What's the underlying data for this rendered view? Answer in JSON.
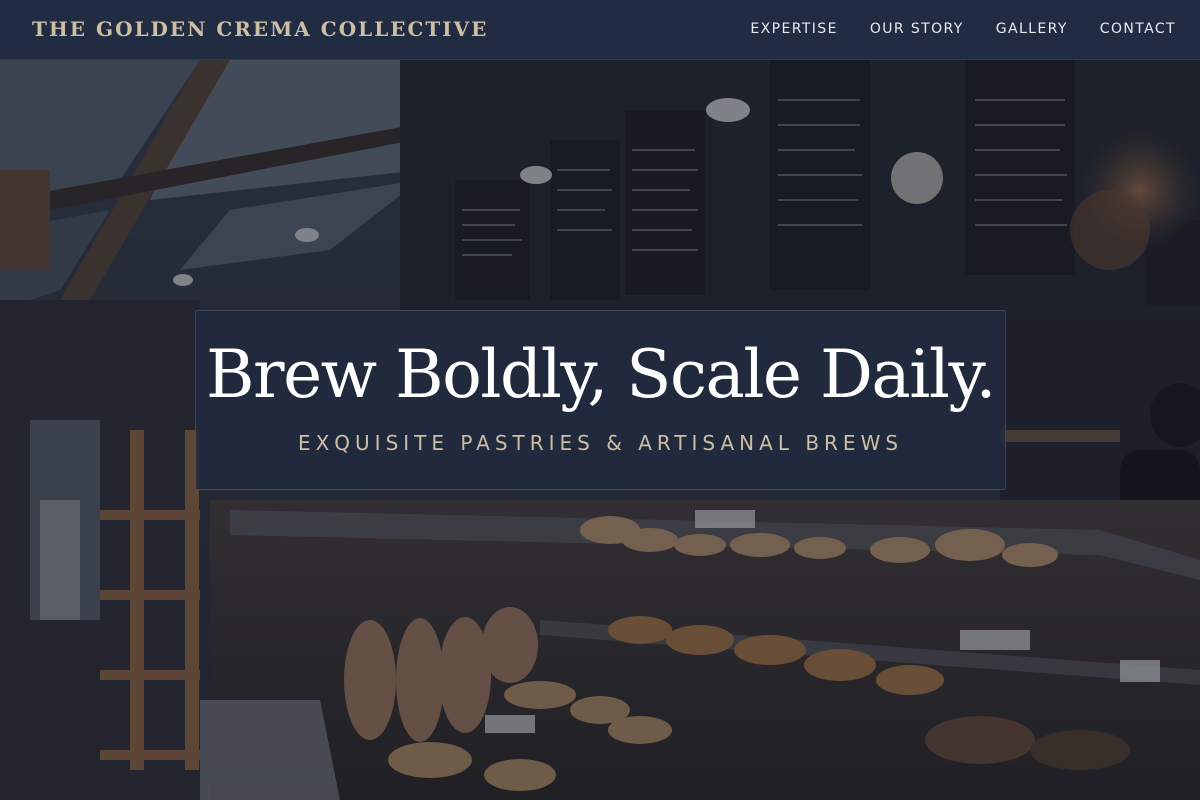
{
  "brand": {
    "name": "THE GOLDEN CREMA COLLECTIVE"
  },
  "nav": {
    "items": [
      {
        "label": "EXPERTISE"
      },
      {
        "label": "OUR STORY"
      },
      {
        "label": "GALLERY"
      },
      {
        "label": "CONTACT"
      }
    ]
  },
  "hero": {
    "title": "Brew Boldly, Scale Daily.",
    "subtitle": "EXQUISITE PASTRIES & ARTISANAL BREWS",
    "background": "bakery-interior-photo"
  },
  "colors": {
    "navbar_bg": "#212b42",
    "brand_text": "#cdbfa5",
    "nav_text": "#e8eaf0",
    "panel_bg": "#21293e",
    "title_text": "#ffffff",
    "subtitle_text": "#cdbfa5"
  }
}
